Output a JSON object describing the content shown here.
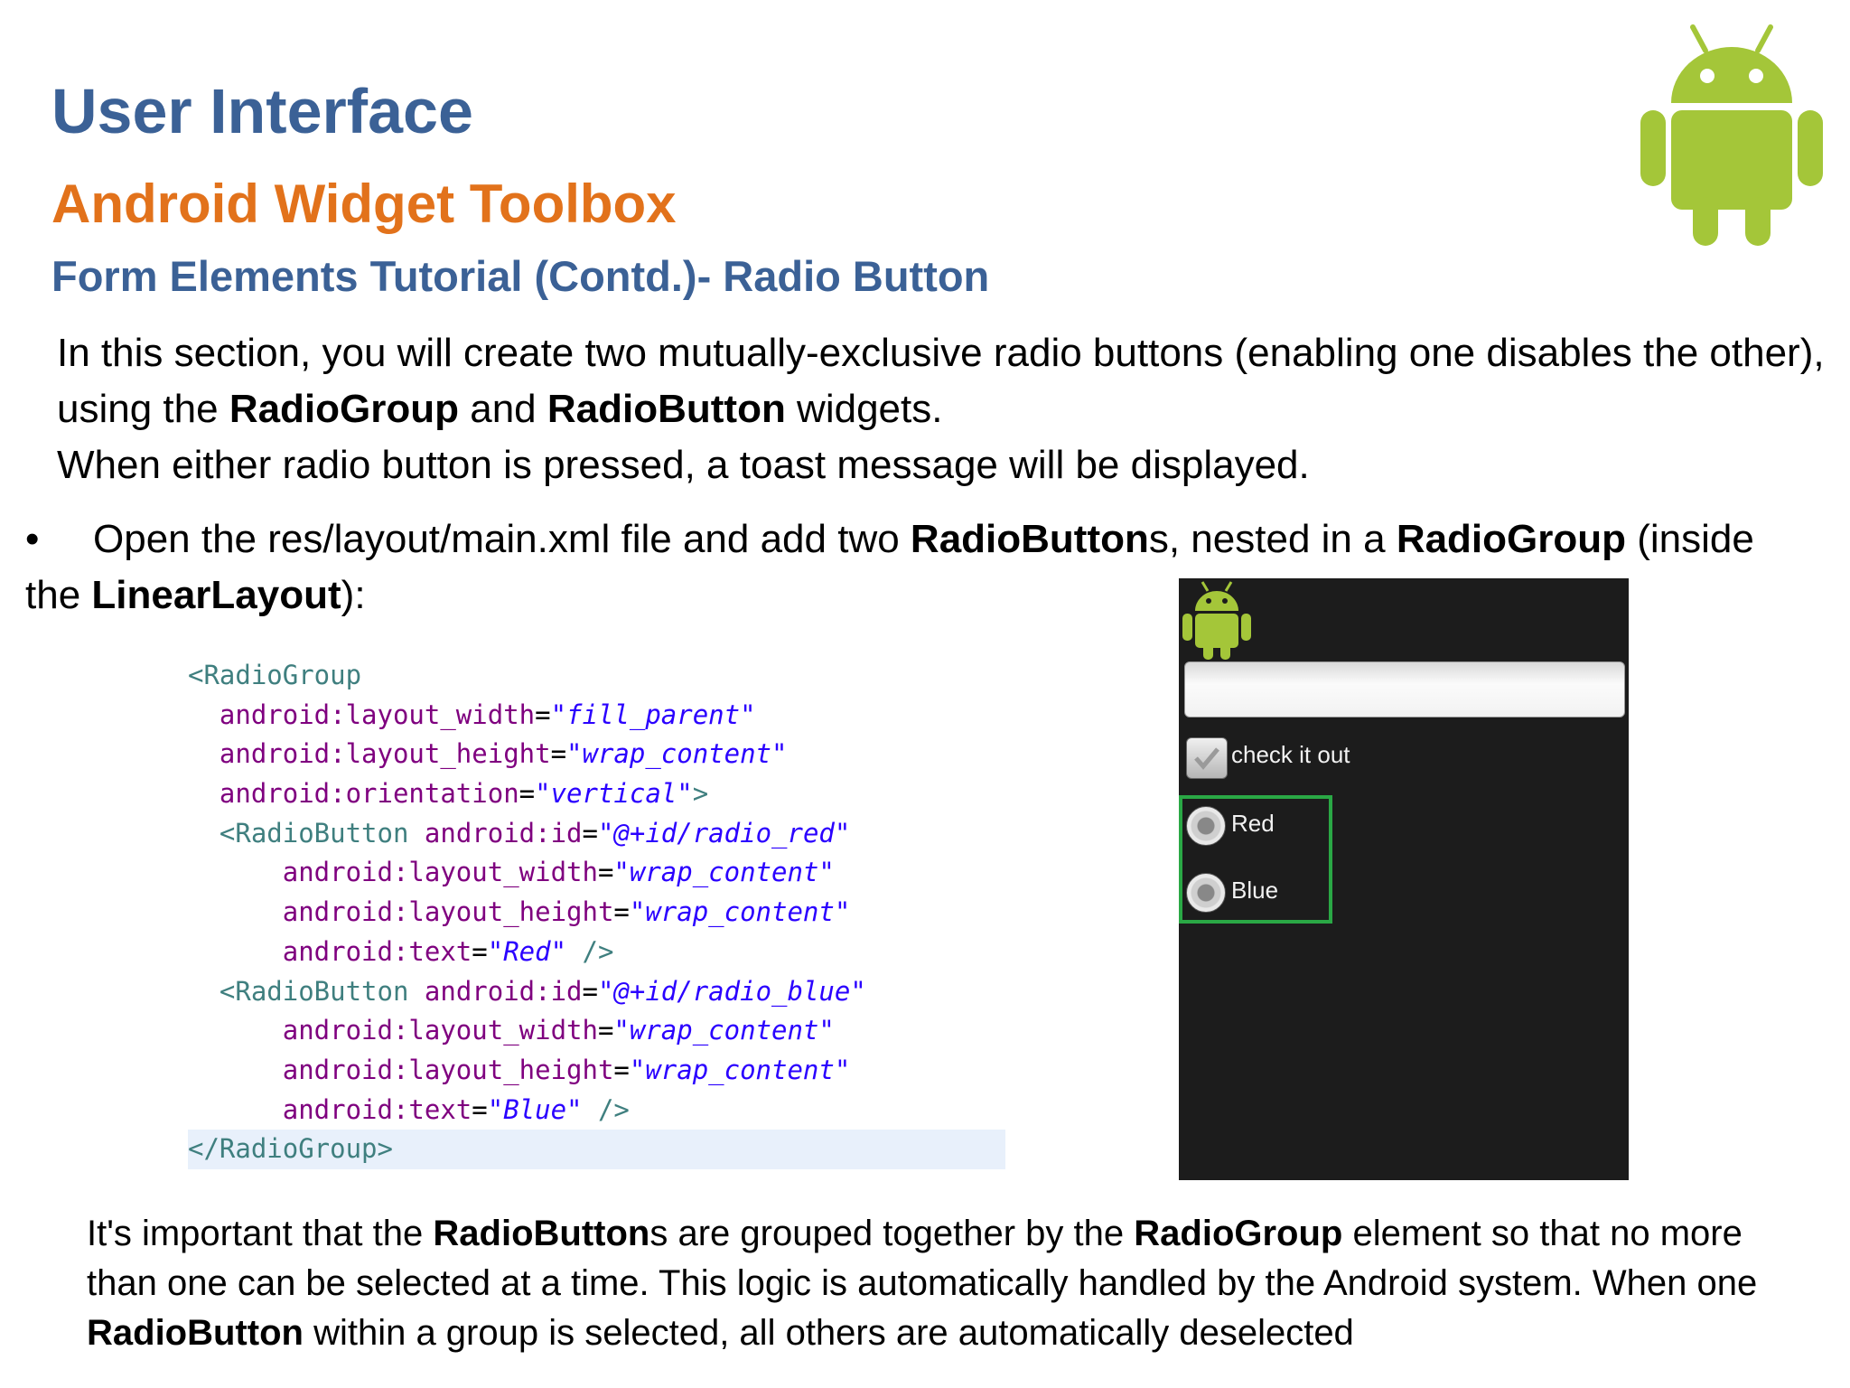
{
  "header": {
    "title": "User Interface",
    "subtitle": "Android Widget Toolbox",
    "section": "Form Elements Tutorial (Contd.)- Radio Button"
  },
  "intro": {
    "line1_a": "In this section, you will create two mutually-exclusive radio buttons (enabling one disables the other), using the ",
    "line1_b1": "RadioGroup",
    "line1_c": " and ",
    "line1_b2": "RadioButton",
    "line1_d": " widgets.",
    "line2": "When either radio button is pressed, a toast message will be displayed."
  },
  "bullet": {
    "symbol": "•",
    "a": "Open the res/layout/main.xml file and add two ",
    "b1": "RadioButton",
    "c": "s, nested in a ",
    "b2": "RadioGroup",
    "d": " (inside the ",
    "b3": "LinearLayout",
    "e": "):"
  },
  "code": {
    "l1_tag": "<RadioGroup",
    "l2_attr": "  android:layout_width",
    "l2_val": "\"fill_parent\"",
    "l3_attr": "  android:layout_height",
    "l3_val": "\"wrap_content\"",
    "l4_attr": "  android:orientation",
    "l4_val": "\"vertical\"",
    "l4_tag": ">",
    "l5_tag": "  <RadioButton",
    "l5_attr": " android:id",
    "l5_val": "\"@+id/radio_red\"",
    "l6_attr": "      android:layout_width",
    "l6_val": "\"wrap_content\"",
    "l7_attr": "      android:layout_height",
    "l7_val": "\"wrap_content\"",
    "l8_attr": "      android:text",
    "l8_val": "\"Red\"",
    "l8_tag": " />",
    "l9_tag": "  <RadioButton",
    "l9_attr": " android:id",
    "l9_val": "\"@+id/radio_blue\"",
    "l10_attr": "      android:layout_width",
    "l10_val": "\"wrap_content\"",
    "l11_attr": "      android:layout_height",
    "l11_val": "\"wrap_content\"",
    "l12_attr": "      android:text",
    "l12_val": "\"Blue\"",
    "l12_tag": " />",
    "l13_tag": "</RadioGroup>",
    "eq": "="
  },
  "phone": {
    "checkbox_label": "check it out",
    "radio_red": "Red",
    "radio_blue": "Blue"
  },
  "footer": {
    "a": "It's important that the ",
    "b1": "RadioButton",
    "c": "s are grouped together by the ",
    "b2": "RadioGroup",
    "d": " element so that no more than one can be selected at a time. This logic is automatically handled by the Android system. When one ",
    "b3": "RadioButton",
    "e": " within a group is selected, all others are automatically deselected"
  },
  "colors": {
    "title": "#3b6196",
    "subtitle": "#e2721b",
    "android_green": "#a4c639",
    "group_border": "#2aa845"
  },
  "icons": {
    "logo": "android-robot-icon"
  }
}
